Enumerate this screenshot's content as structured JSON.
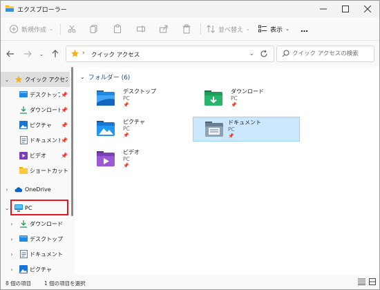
{
  "window": {
    "title": "エクスプローラー"
  },
  "toolbar": {
    "new_label": "新規作成",
    "sort_label": "並べ替え",
    "view_label": "表示",
    "more_label": "…"
  },
  "address": {
    "path": "クイック アクセス",
    "search_placeholder": "クイック アクセスの検索"
  },
  "sidebar": {
    "quick_access": "クイック アクセス",
    "quick_items": [
      "デスクトップ",
      "ダウンロード",
      "ピクチャ",
      "ドキュメント",
      "ビデオ",
      "ショートカットイ"
    ],
    "onedrive": "OneDrive",
    "pc": "PC",
    "pc_items": [
      "ダウンロード",
      "デスクトップ",
      "ドキュメント",
      "ピクチャ"
    ]
  },
  "content": {
    "group_title": "フォルダー (6)",
    "folders": [
      {
        "name": "デスクトップ",
        "location": "PC"
      },
      {
        "name": "ダウンロード",
        "location": "PC"
      },
      {
        "name": "ピクチャ",
        "location": "PC"
      },
      {
        "name": "ドキュメント",
        "location": "PC"
      },
      {
        "name": "ビデオ",
        "location": "PC"
      }
    ]
  },
  "status": {
    "item_count": "8 個の項目",
    "selected": "1 個の項目を選択"
  },
  "colors": {
    "accent": "#0067c0",
    "selection": "#cce8ff",
    "highlight_box": "#e8141a"
  }
}
